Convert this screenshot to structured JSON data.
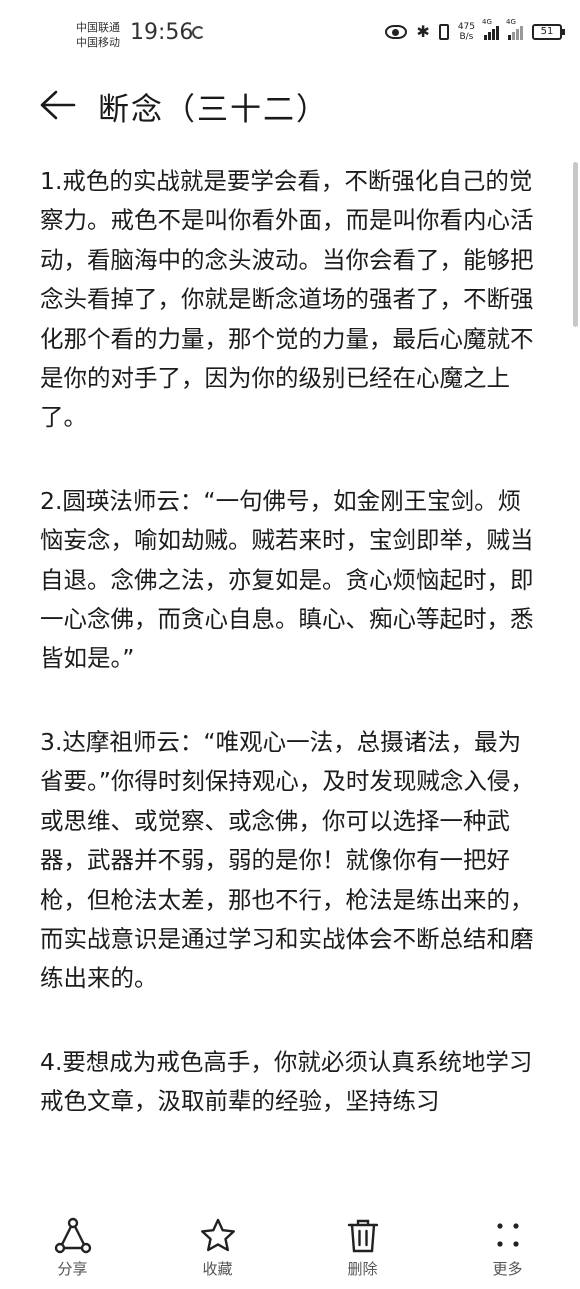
{
  "status_bar": {
    "carrier_1": "中国联通",
    "carrier_2": "中国移动",
    "time": "19:56",
    "net_speed_value": "475",
    "net_speed_unit": "B/s",
    "signal_1_label": "4G",
    "signal_2_label": "4G",
    "battery": "51"
  },
  "header": {
    "back_icon": "arrow-left-icon",
    "title": "断念（三十二）"
  },
  "article": {
    "paragraphs": [
      "1.戒色的实战就是要学会看，不断强化自己的觉察力。戒色不是叫你看外面，而是叫你看内心活动，看脑海中的念头波动。当你会看了，能够把念头看掉了，你就是断念道场的强者了，不断强化那个看的力量，那个觉的力量，最后心魔就不是你的对手了，因为你的级别已经在心魔之上了。",
      "2.圆瑛法师云：“一句佛号，如金刚王宝剑。烦恼妄念，喻如劫贼。贼若来时，宝剑即举，贼当自退。念佛之法，亦复如是。贪心烦恼起时，即一心念佛，而贪心自息。瞋心、痴心等起时，悉皆如是。”",
      "3.达摩祖师云：“唯观心一法，总摄诸法，最为省要。”你得时刻保持观心，及时发现贼念入侵，或思维、或觉察、或念佛，你可以选择一种武器，武器并不弱，弱的是你！就像你有一把好枪，但枪法太差，那也不行，枪法是练出来的，而实战意识是通过学习和实战体会不断总结和磨练出来的。",
      "4.要想成为戒色高手，你就必须认真系统地学习戒色文章，汲取前辈的经验，坚持练习"
    ]
  },
  "toolbar": {
    "items": [
      {
        "label": "分享",
        "icon": "share-icon"
      },
      {
        "label": "收藏",
        "icon": "star-icon"
      },
      {
        "label": "删除",
        "icon": "trash-icon"
      },
      {
        "label": "更多",
        "icon": "more-icon"
      }
    ]
  },
  "colors": {
    "text": "#1c1c1c",
    "background": "#ffffff",
    "icon": "#222222"
  }
}
